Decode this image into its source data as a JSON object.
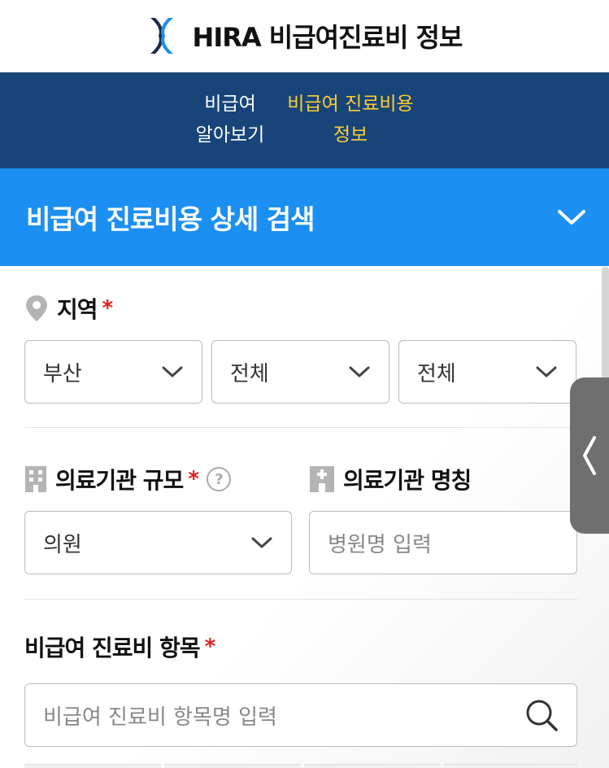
{
  "header": {
    "title": "HIRA 비급여진료비 정보"
  },
  "nav": {
    "item1_line1": "비급여",
    "item1_line2": "알아보기",
    "item2_line1": "비급여 진료비용",
    "item2_line2": "정보"
  },
  "search_bar": {
    "title": "비급여 진료비용 상세 검색"
  },
  "region": {
    "label": "지역",
    "required": "*",
    "select1": "부산",
    "select2": "전체",
    "select3": "전체"
  },
  "institution_size": {
    "label": "의료기관 규모",
    "required": "*",
    "help": "?",
    "value": "의원"
  },
  "institution_name": {
    "label": "의료기관 명칭",
    "placeholder": "병원명 입력"
  },
  "item": {
    "label": "비급여 진료비 항목",
    "required": "*",
    "placeholder": "비급여 진료비 항목명 입력"
  },
  "colors": {
    "nav_bg": "#17457a",
    "accent_yellow": "#ffcc33",
    "bar_blue": "#1c8ff2",
    "required_red": "#e02020"
  }
}
